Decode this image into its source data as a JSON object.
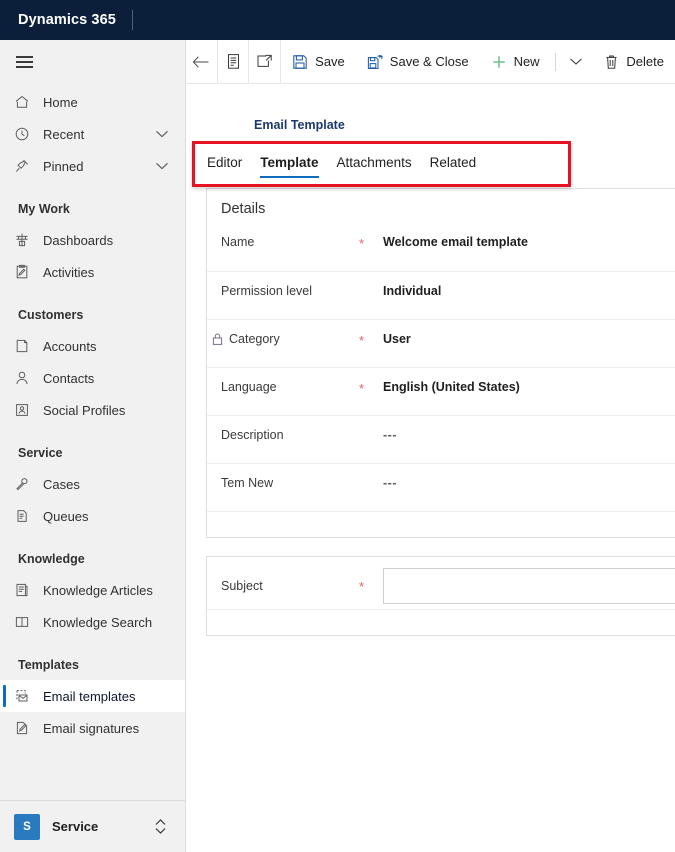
{
  "topbar": {
    "brand": "Dynamics 365"
  },
  "sidebar": {
    "hamburger_name": "site-map-toggle",
    "items": [
      {
        "type": "item",
        "label": "Home",
        "icon": "home-icon"
      },
      {
        "type": "item",
        "label": "Recent",
        "icon": "clock-icon",
        "chevron": true
      },
      {
        "type": "item",
        "label": "Pinned",
        "icon": "pin-icon",
        "chevron": true
      },
      {
        "type": "group",
        "label": "My Work"
      },
      {
        "type": "item",
        "label": "Dashboards",
        "icon": "dashboard-icon"
      },
      {
        "type": "item",
        "label": "Activities",
        "icon": "activities-icon"
      },
      {
        "type": "group",
        "label": "Customers"
      },
      {
        "type": "item",
        "label": "Accounts",
        "icon": "account-icon"
      },
      {
        "type": "item",
        "label": "Contacts",
        "icon": "contact-icon"
      },
      {
        "type": "item",
        "label": "Social Profiles",
        "icon": "social-profile-icon"
      },
      {
        "type": "group",
        "label": "Service"
      },
      {
        "type": "item",
        "label": "Cases",
        "icon": "case-icon"
      },
      {
        "type": "item",
        "label": "Queues",
        "icon": "queue-icon"
      },
      {
        "type": "group",
        "label": "Knowledge"
      },
      {
        "type": "item",
        "label": "Knowledge Articles",
        "icon": "knowledge-article-icon"
      },
      {
        "type": "item",
        "label": "Knowledge Search",
        "icon": "book-icon"
      },
      {
        "type": "group",
        "label": "Templates"
      },
      {
        "type": "item",
        "label": "Email templates",
        "icon": "email-template-icon",
        "active": true
      },
      {
        "type": "item",
        "label": "Email signatures",
        "icon": "email-signature-icon"
      }
    ],
    "footer": {
      "badge": "S",
      "label": "Service",
      "switcher_icon": "up-down-chevron-icon"
    }
  },
  "commandbar": {
    "back_icon": "back-arrow-icon",
    "form_icon": "form-selector-icon",
    "popout_icon": "open-in-new-window-icon",
    "save_label": "Save",
    "save_icon": "save-icon",
    "save_close_label": "Save & Close",
    "save_close_icon": "save-and-close-icon",
    "new_label": "New",
    "new_icon": "plus-icon",
    "overflow_icon": "chevron-down-icon",
    "delete_label": "Delete",
    "delete_icon": "trash-icon"
  },
  "main": {
    "entity_title": "Email Template",
    "tabs": [
      {
        "label": "Editor",
        "selected": false
      },
      {
        "label": "Template",
        "selected": true
      },
      {
        "label": "Attachments",
        "selected": false
      },
      {
        "label": "Related",
        "selected": false
      }
    ],
    "highlight": {
      "name": "tab-strip-highlight",
      "color": "#e81123"
    },
    "details": {
      "title": "Details",
      "fields": [
        {
          "label": "Name",
          "required": "*",
          "value": "Welcome email template",
          "locked": false
        },
        {
          "label": "Permission level",
          "required": "",
          "value": "Individual",
          "locked": false
        },
        {
          "label": "Category",
          "required": "*",
          "value": "User",
          "locked": true,
          "lock_icon": "lock-icon"
        },
        {
          "label": "Language",
          "required": "*",
          "value": "English (United States)",
          "locked": false
        },
        {
          "label": "Description",
          "required": "",
          "value": "---",
          "locked": false,
          "muted": true
        },
        {
          "label": "Tem New",
          "required": "",
          "value": "---",
          "locked": false,
          "muted": true
        }
      ]
    },
    "subject": {
      "label": "Subject",
      "required": "*",
      "value": "",
      "placeholder": ""
    }
  }
}
